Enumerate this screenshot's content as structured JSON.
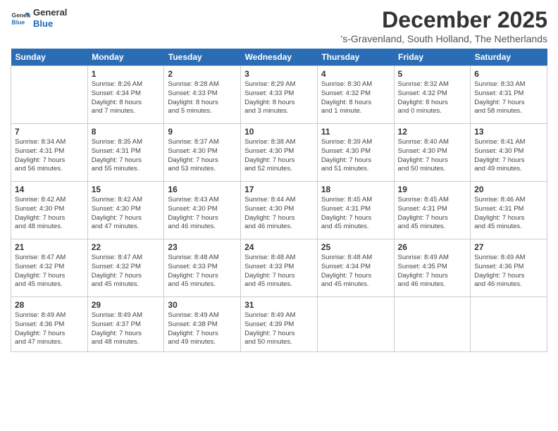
{
  "header": {
    "logo_line1": "General",
    "logo_line2": "Blue",
    "month_title": "December 2025",
    "location": "'s-Gravenland, South Holland, The Netherlands"
  },
  "days_of_week": [
    "Sunday",
    "Monday",
    "Tuesday",
    "Wednesday",
    "Thursday",
    "Friday",
    "Saturday"
  ],
  "weeks": [
    [
      {
        "day": "",
        "info": ""
      },
      {
        "day": "1",
        "info": "Sunrise: 8:26 AM\nSunset: 4:34 PM\nDaylight: 8 hours\nand 7 minutes."
      },
      {
        "day": "2",
        "info": "Sunrise: 8:28 AM\nSunset: 4:33 PM\nDaylight: 8 hours\nand 5 minutes."
      },
      {
        "day": "3",
        "info": "Sunrise: 8:29 AM\nSunset: 4:33 PM\nDaylight: 8 hours\nand 3 minutes."
      },
      {
        "day": "4",
        "info": "Sunrise: 8:30 AM\nSunset: 4:32 PM\nDaylight: 8 hours\nand 1 minute."
      },
      {
        "day": "5",
        "info": "Sunrise: 8:32 AM\nSunset: 4:32 PM\nDaylight: 8 hours\nand 0 minutes."
      },
      {
        "day": "6",
        "info": "Sunrise: 8:33 AM\nSunset: 4:31 PM\nDaylight: 7 hours\nand 58 minutes."
      }
    ],
    [
      {
        "day": "7",
        "info": "Sunrise: 8:34 AM\nSunset: 4:31 PM\nDaylight: 7 hours\nand 56 minutes."
      },
      {
        "day": "8",
        "info": "Sunrise: 8:35 AM\nSunset: 4:31 PM\nDaylight: 7 hours\nand 55 minutes."
      },
      {
        "day": "9",
        "info": "Sunrise: 8:37 AM\nSunset: 4:30 PM\nDaylight: 7 hours\nand 53 minutes."
      },
      {
        "day": "10",
        "info": "Sunrise: 8:38 AM\nSunset: 4:30 PM\nDaylight: 7 hours\nand 52 minutes."
      },
      {
        "day": "11",
        "info": "Sunrise: 8:39 AM\nSunset: 4:30 PM\nDaylight: 7 hours\nand 51 minutes."
      },
      {
        "day": "12",
        "info": "Sunrise: 8:40 AM\nSunset: 4:30 PM\nDaylight: 7 hours\nand 50 minutes."
      },
      {
        "day": "13",
        "info": "Sunrise: 8:41 AM\nSunset: 4:30 PM\nDaylight: 7 hours\nand 49 minutes."
      }
    ],
    [
      {
        "day": "14",
        "info": "Sunrise: 8:42 AM\nSunset: 4:30 PM\nDaylight: 7 hours\nand 48 minutes."
      },
      {
        "day": "15",
        "info": "Sunrise: 8:42 AM\nSunset: 4:30 PM\nDaylight: 7 hours\nand 47 minutes."
      },
      {
        "day": "16",
        "info": "Sunrise: 8:43 AM\nSunset: 4:30 PM\nDaylight: 7 hours\nand 46 minutes."
      },
      {
        "day": "17",
        "info": "Sunrise: 8:44 AM\nSunset: 4:30 PM\nDaylight: 7 hours\nand 46 minutes."
      },
      {
        "day": "18",
        "info": "Sunrise: 8:45 AM\nSunset: 4:31 PM\nDaylight: 7 hours\nand 45 minutes."
      },
      {
        "day": "19",
        "info": "Sunrise: 8:45 AM\nSunset: 4:31 PM\nDaylight: 7 hours\nand 45 minutes."
      },
      {
        "day": "20",
        "info": "Sunrise: 8:46 AM\nSunset: 4:31 PM\nDaylight: 7 hours\nand 45 minutes."
      }
    ],
    [
      {
        "day": "21",
        "info": "Sunrise: 8:47 AM\nSunset: 4:32 PM\nDaylight: 7 hours\nand 45 minutes."
      },
      {
        "day": "22",
        "info": "Sunrise: 8:47 AM\nSunset: 4:32 PM\nDaylight: 7 hours\nand 45 minutes."
      },
      {
        "day": "23",
        "info": "Sunrise: 8:48 AM\nSunset: 4:33 PM\nDaylight: 7 hours\nand 45 minutes."
      },
      {
        "day": "24",
        "info": "Sunrise: 8:48 AM\nSunset: 4:33 PM\nDaylight: 7 hours\nand 45 minutes."
      },
      {
        "day": "25",
        "info": "Sunrise: 8:48 AM\nSunset: 4:34 PM\nDaylight: 7 hours\nand 45 minutes."
      },
      {
        "day": "26",
        "info": "Sunrise: 8:49 AM\nSunset: 4:35 PM\nDaylight: 7 hours\nand 46 minutes."
      },
      {
        "day": "27",
        "info": "Sunrise: 8:49 AM\nSunset: 4:36 PM\nDaylight: 7 hours\nand 46 minutes."
      }
    ],
    [
      {
        "day": "28",
        "info": "Sunrise: 8:49 AM\nSunset: 4:36 PM\nDaylight: 7 hours\nand 47 minutes."
      },
      {
        "day": "29",
        "info": "Sunrise: 8:49 AM\nSunset: 4:37 PM\nDaylight: 7 hours\nand 48 minutes."
      },
      {
        "day": "30",
        "info": "Sunrise: 8:49 AM\nSunset: 4:38 PM\nDaylight: 7 hours\nand 49 minutes."
      },
      {
        "day": "31",
        "info": "Sunrise: 8:49 AM\nSunset: 4:39 PM\nDaylight: 7 hours\nand 50 minutes."
      },
      {
        "day": "",
        "info": ""
      },
      {
        "day": "",
        "info": ""
      },
      {
        "day": "",
        "info": ""
      }
    ]
  ]
}
